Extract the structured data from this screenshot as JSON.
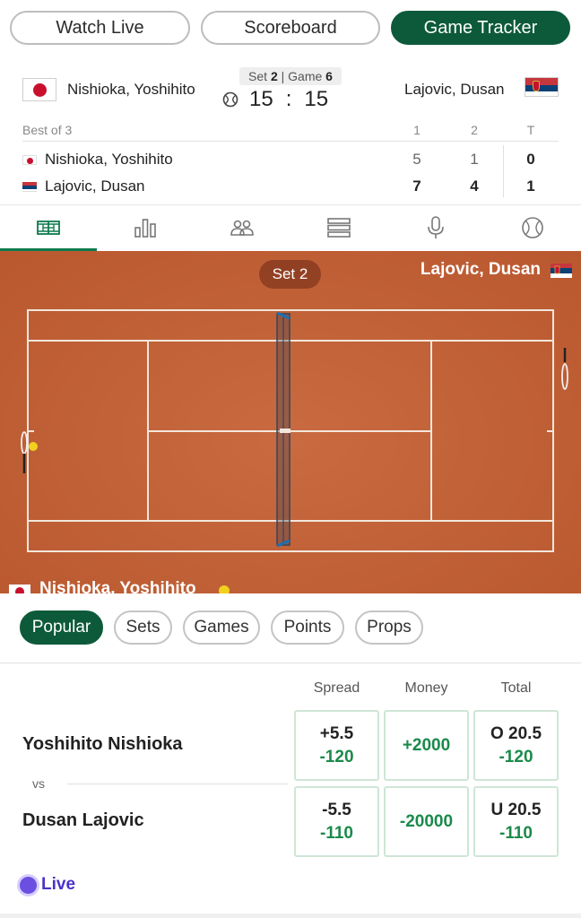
{
  "top_tabs": {
    "watch_live": "Watch Live",
    "scoreboard": "Scoreboard",
    "game_tracker": "Game Tracker"
  },
  "header": {
    "player1": "Nishioka, Yoshihito",
    "player2": "Lajovic, Dusan",
    "set_label": "Set",
    "set_num": "2",
    "game_label": "Game",
    "game_num": "6",
    "point_p1": "15",
    "point_sep": ":",
    "point_p2": "15"
  },
  "scoreboard": {
    "format": "Best of 3",
    "col_headers": [
      "1",
      "2",
      "T"
    ],
    "rows": [
      {
        "name": "Nishioka, Yoshihito",
        "set1": "5",
        "set2": "1",
        "total": "0"
      },
      {
        "name": "Lajovic, Dusan",
        "set1": "7",
        "set2": "4",
        "total": "1"
      }
    ]
  },
  "icon_tabs": [
    "court-icon",
    "stats-icon",
    "head-to-head-icon",
    "list-icon",
    "microphone-icon",
    "tennis-ball-icon"
  ],
  "court": {
    "set_label": "Set 2",
    "top_player": "Lajovic, Dusan",
    "bottom_player": "Nishioka, Yoshihito"
  },
  "bet_tabs": [
    "Popular",
    "Sets",
    "Games",
    "Points",
    "Props"
  ],
  "odds": {
    "columns": [
      "Spread",
      "Money",
      "Total"
    ],
    "team1": "Yoshihito Nishioka",
    "vs": "vs",
    "team2": "Dusan Lajovic",
    "team1_spread_line": "+5.5",
    "team1_spread_price": "-120",
    "team1_money": "+2000",
    "team1_total_line": "O 20.5",
    "team1_total_price": "-120",
    "team2_spread_line": "-5.5",
    "team2_spread_price": "-110",
    "team2_money": "-20000",
    "team2_total_line": "U 20.5",
    "team2_total_price": "-110"
  },
  "live_label": "Live",
  "colors": {
    "brand_green": "#0d5a3a",
    "odds_green": "#1a8a4a",
    "clay": "#c1603a",
    "live_purple": "#6a4fe0"
  }
}
